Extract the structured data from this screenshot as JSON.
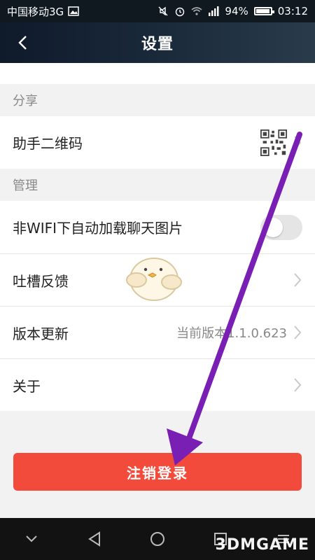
{
  "status_bar": {
    "carrier": "中国移动3G",
    "battery": "94%",
    "battery_level": 0.94,
    "time": "03:12"
  },
  "header": {
    "title": "设置"
  },
  "sections": {
    "share": "分享",
    "manage": "管理"
  },
  "rows": {
    "helper_qr": "助手二维码",
    "auto_download": "非WIFI下自动加载聊天图片",
    "feedback": "吐槽反馈",
    "update": "版本更新",
    "current_version": "当前版本1.1.0.623",
    "about": "关于"
  },
  "buttons": {
    "logout": "注销登录"
  },
  "watermark": "3DMGAME",
  "colors": {
    "accent_red": "#f24a3b",
    "annotation_purple": "#7a1fb3"
  }
}
